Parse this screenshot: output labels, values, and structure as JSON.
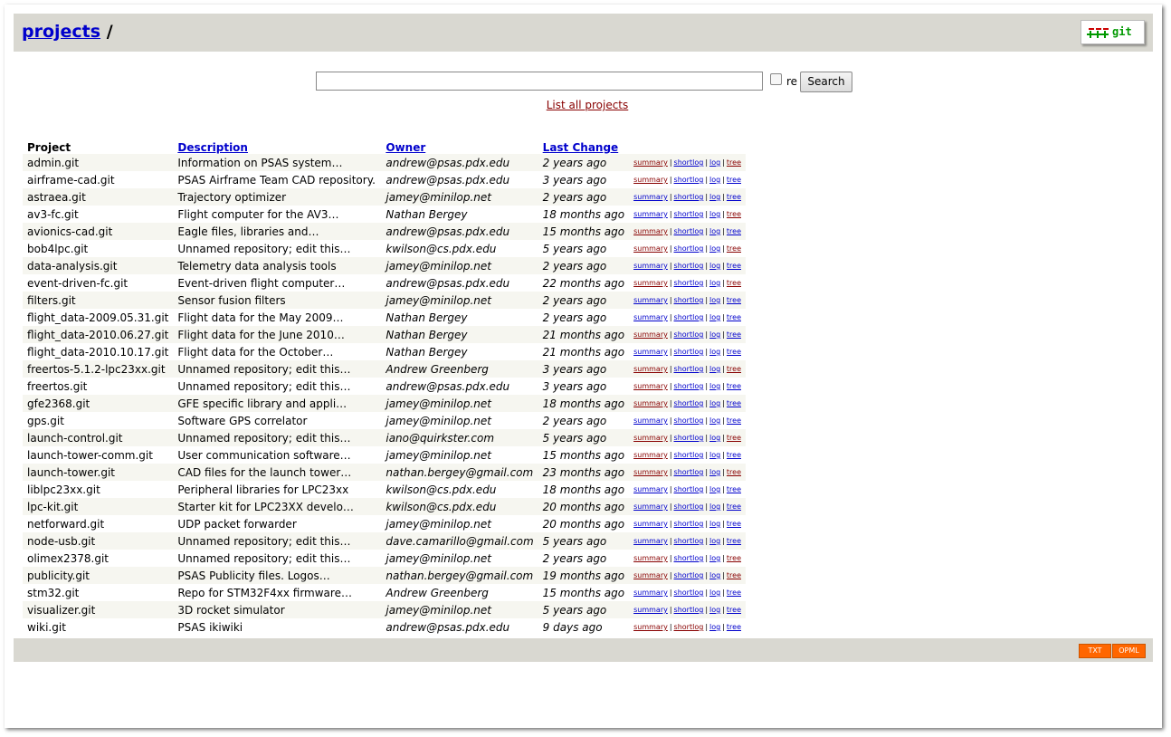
{
  "header": {
    "title_link": "projects",
    "title_sep": "/",
    "logo_text": "git"
  },
  "search": {
    "value": "",
    "placeholder": "",
    "re_label": "re",
    "button_label": "Search",
    "list_all": "List all projects"
  },
  "columns": {
    "project": "Project",
    "description": "Description",
    "owner": "Owner",
    "last_change": "Last Change"
  },
  "link_labels": [
    "summary",
    "shortlog",
    "log",
    "tree"
  ],
  "rows": [
    {
      "name": "admin.git",
      "desc": "Information on PSAS system…",
      "owner": "andrew@psas.pdx.edu",
      "age": "2 years ago"
    },
    {
      "name": "airframe-cad.git",
      "desc": "PSAS Airframe Team CAD repository.",
      "owner": "andrew@psas.pdx.edu",
      "age": "3 years ago"
    },
    {
      "name": "astraea.git",
      "desc": "Trajectory optimizer",
      "owner": "jamey@minilop.net",
      "age": "2 years ago"
    },
    {
      "name": "av3-fc.git",
      "desc": "Flight computer for the AV3…",
      "owner": "Nathan Bergey",
      "age": "18 months ago"
    },
    {
      "name": "avionics-cad.git",
      "desc": "Eagle files, libraries and…",
      "owner": "andrew@psas.pdx.edu",
      "age": "15 months ago"
    },
    {
      "name": "bob4lpc.git",
      "desc": "Unnamed repository; edit this…",
      "owner": "kwilson@cs.pdx.edu",
      "age": "5 years ago"
    },
    {
      "name": "data-analysis.git",
      "desc": "Telemetry data analysis tools",
      "owner": "jamey@minilop.net",
      "age": "2 years ago"
    },
    {
      "name": "event-driven-fc.git",
      "desc": "Event-driven flight computer…",
      "owner": "andrew@psas.pdx.edu",
      "age": "22 months ago"
    },
    {
      "name": "filters.git",
      "desc": "Sensor fusion filters",
      "owner": "jamey@minilop.net",
      "age": "2 years ago"
    },
    {
      "name": "flight_data-2009.05.31.git",
      "desc": "Flight data for the May 2009…",
      "owner": "Nathan Bergey",
      "age": "2 years ago"
    },
    {
      "name": "flight_data-2010.06.27.git",
      "desc": "Flight data for the June 2010…",
      "owner": "Nathan Bergey",
      "age": "21 months ago"
    },
    {
      "name": "flight_data-2010.10.17.git",
      "desc": "Flight data for the October…",
      "owner": "Nathan Bergey",
      "age": "21 months ago"
    },
    {
      "name": "freertos-5.1.2-lpc23xx.git",
      "desc": "Unnamed repository; edit this…",
      "owner": "Andrew Greenberg",
      "age": "3 years ago"
    },
    {
      "name": "freertos.git",
      "desc": "Unnamed repository; edit this…",
      "owner": "andrew@psas.pdx.edu",
      "age": "3 years ago"
    },
    {
      "name": "gfe2368.git",
      "desc": "GFE specific library and appli…",
      "owner": "jamey@minilop.net",
      "age": "18 months ago"
    },
    {
      "name": "gps.git",
      "desc": "Software GPS correlator",
      "owner": "jamey@minilop.net",
      "age": "2 years ago"
    },
    {
      "name": "launch-control.git",
      "desc": "Unnamed repository; edit this…",
      "owner": "iano@quirkster.com",
      "age": "5 years ago"
    },
    {
      "name": "launch-tower-comm.git",
      "desc": "User communication software…",
      "owner": "jamey@minilop.net",
      "age": "15 months ago"
    },
    {
      "name": "launch-tower.git",
      "desc": "CAD files for the launch tower…",
      "owner": "nathan.bergey@gmail.com",
      "age": "23 months ago"
    },
    {
      "name": "liblpc23xx.git",
      "desc": "Peripheral libraries for LPC23xx",
      "owner": "kwilson@cs.pdx.edu",
      "age": "18 months ago"
    },
    {
      "name": "lpc-kit.git",
      "desc": "Starter kit for LPC23XX develo…",
      "owner": "kwilson@cs.pdx.edu",
      "age": "20 months ago"
    },
    {
      "name": "netforward.git",
      "desc": "UDP packet forwarder",
      "owner": "jamey@minilop.net",
      "age": "20 months ago"
    },
    {
      "name": "node-usb.git",
      "desc": "Unnamed repository; edit this…",
      "owner": "dave.camarillo@gmail.com",
      "age": "5 years ago"
    },
    {
      "name": "olimex2378.git",
      "desc": "Unnamed repository; edit this…",
      "owner": "jamey@minilop.net",
      "age": "2 years ago"
    },
    {
      "name": "publicity.git",
      "desc": "PSAS Publicity files. Logos…",
      "owner": "nathan.bergey@gmail.com",
      "age": "19 months ago"
    },
    {
      "name": "stm32.git",
      "desc": "Repo for STM32F4xx firmware…",
      "owner": "Andrew Greenberg",
      "age": "15 months ago"
    },
    {
      "name": "visualizer.git",
      "desc": "3D rocket simulator",
      "owner": "jamey@minilop.net",
      "age": "5 years ago"
    },
    {
      "name": "wiki.git",
      "desc": "PSAS ikiwiki",
      "owner": "andrew@psas.pdx.edu",
      "age": "9 days ago"
    }
  ],
  "footer": {
    "txt_label": "TXT",
    "opml_label": "OPML"
  },
  "colors": {
    "header_bg": "#d9d8d1",
    "link": "#0000cc",
    "visited_link": "#880000",
    "row_alt": "#f6f6f0",
    "feed_button": "#ff6600"
  }
}
